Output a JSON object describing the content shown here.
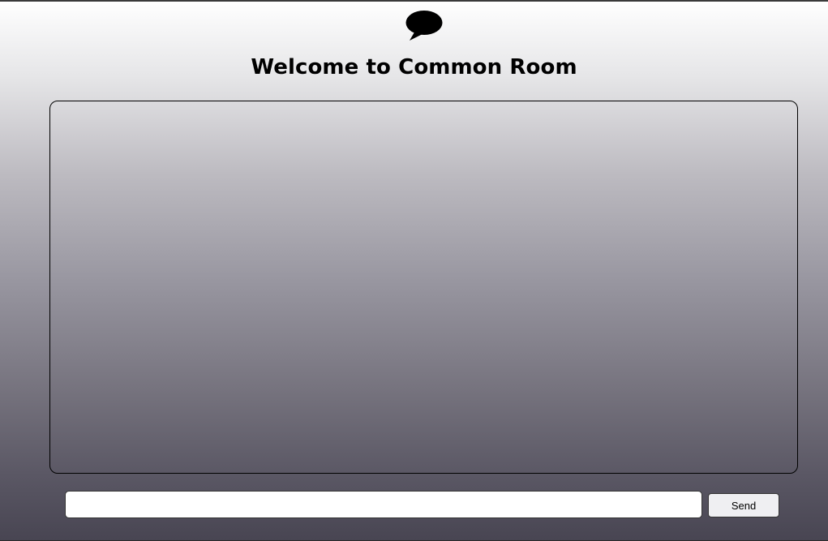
{
  "header": {
    "logo_icon": "speech-bubble-icon",
    "title": "Welcome to Common Room"
  },
  "chat": {
    "messages": []
  },
  "composer": {
    "input_value": "",
    "input_placeholder": "",
    "send_label": "Send"
  }
}
